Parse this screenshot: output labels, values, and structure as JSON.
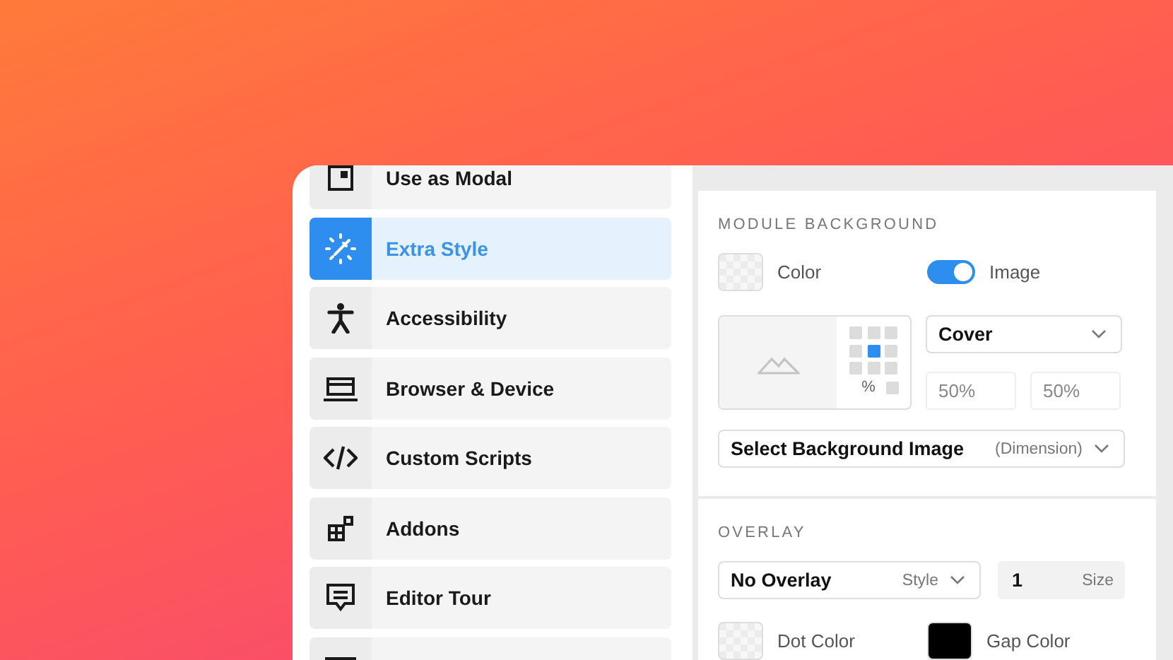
{
  "sidebar": {
    "items": [
      {
        "label": "Use as Modal",
        "selected": false
      },
      {
        "label": "Extra Style",
        "selected": true
      },
      {
        "label": "Accessibility",
        "selected": false
      },
      {
        "label": "Browser & Device",
        "selected": false
      },
      {
        "label": "Custom Scripts",
        "selected": false
      },
      {
        "label": "Addons",
        "selected": false
      },
      {
        "label": "Editor Tour",
        "selected": false
      }
    ]
  },
  "module_background": {
    "title": "MODULE BACKGROUND",
    "color": {
      "label": "Color"
    },
    "image_toggle": {
      "label": "Image",
      "on": true
    },
    "anchor_cells": [
      {
        "selected": false
      },
      {
        "selected": false
      },
      {
        "selected": false
      },
      {
        "selected": false
      },
      {
        "selected": true
      },
      {
        "selected": false
      },
      {
        "selected": false
      },
      {
        "selected": false
      },
      {
        "selected": false
      }
    ],
    "unit": "%",
    "fit_select": {
      "value": "Cover"
    },
    "offsets": [
      {
        "placeholder": "50%"
      },
      {
        "placeholder": "50%"
      }
    ],
    "source_select": {
      "value": "Select Background Image",
      "hint": "(Dimension)"
    }
  },
  "overlay": {
    "title": "OVERLAY",
    "style_select": {
      "value": "No Overlay",
      "hint": "Style"
    },
    "size_field": {
      "value": "1",
      "unit": "Size"
    },
    "swatches": [
      {
        "label": "Dot Color",
        "kind": "transparent"
      },
      {
        "label": "Gap Color",
        "kind": "solid",
        "color": "#000000"
      }
    ]
  }
}
